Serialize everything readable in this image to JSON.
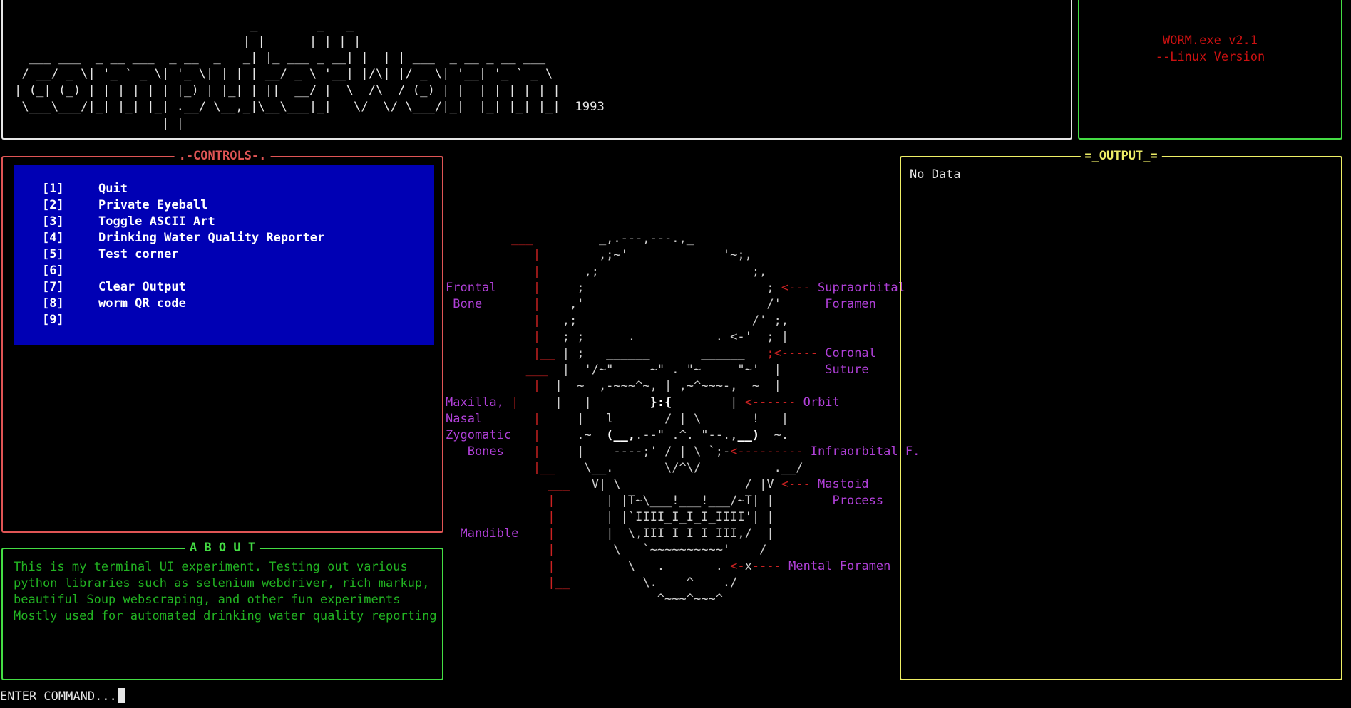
{
  "banner": {
    "art": "                                _        _   _\n                               | |      | | | |\n  ___ ___  _ __ ___  _ __  _   _| |_ ___ _ __| |  | | ___  _ __ _ __ ___\n / __/ _ \\| '_ ` _ \\| '_ \\| | | | __/ _ \\ '__| |/\\| |/ _ \\| '__| '_ ` _ \\\n| (_| (_) | | | | | | |_) | |_| | ||  __/ |  \\  /\\  / (_) | |  | | | | | |\n \\___\\___/|_| |_| |_| .__/ \\__,_|\\__\\___|_|   \\/  \\/ \\___/|_|  |_| |_| |_|  1993\n                    | |"
  },
  "version_box": {
    "line1": "WORM.exe v2.1",
    "line2": "--Linux Version"
  },
  "controls": {
    "title": ".-CONTROLS-.",
    "items": [
      {
        "key": "[1]",
        "label": "Quit"
      },
      {
        "key": "[2]",
        "label": "Private Eyeball"
      },
      {
        "key": "[3]",
        "label": "Toggle ASCII Art"
      },
      {
        "key": "[4]",
        "label": "Drinking Water Quality Reporter"
      },
      {
        "key": "[5]",
        "label": "Test corner"
      },
      {
        "key": "[6]",
        "label": ""
      },
      {
        "key": "[7]",
        "label": "Clear Output"
      },
      {
        "key": "[8]",
        "label": "worm QR code"
      },
      {
        "key": "[9]",
        "label": ""
      }
    ]
  },
  "about": {
    "title": "A B O U T",
    "lines": [
      "This is my terminal UI experiment. Testing out various",
      "python libraries such as selenium webdriver, rich markup,",
      "beautiful Soup webscraping, and other fun experiments",
      "Mostly used for automated drinking water quality reporting"
    ]
  },
  "output": {
    "title": "=_OUTPUT_=",
    "text": "No Data"
  },
  "skull": {
    "labels": {
      "frontal_1": "Frontal",
      "frontal_2": " Bone",
      "maxilla_1": "Maxilla,",
      "maxilla_2": "Nasal",
      "maxilla_3": "Zygomatic",
      "maxilla_4": "   Bones",
      "mandible": "  Mandible",
      "supraorbital_1": "Supraorbital",
      "supraorbital_2": "Foramen",
      "coronal_1": "Coronal",
      "coronal_2": "Suture",
      "orbit": "Orbit",
      "infraorbital": "Infraorbital F.",
      "mastoid_1": "Mastoid",
      "mastoid_2": "Process",
      "mental": "Mental Foramen"
    }
  },
  "command": {
    "prompt": "ENTER COMMAND..."
  }
}
